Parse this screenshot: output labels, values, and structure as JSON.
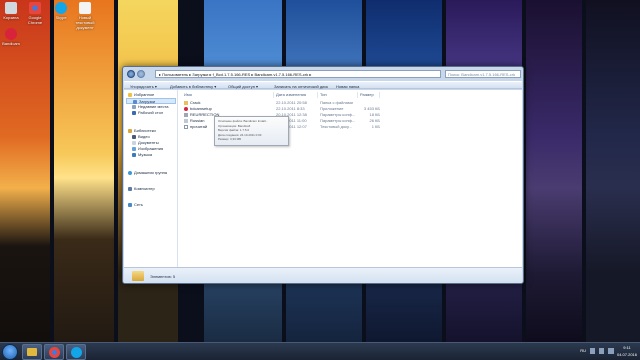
{
  "desktop": {
    "icons": [
      {
        "label": "Корзина",
        "name": "recycle-bin-icon",
        "color": "#d0d8e0"
      },
      {
        "label": "Google Chrome",
        "name": "chrome-icon",
        "color": "#e8453c"
      },
      {
        "label": "Skype",
        "name": "skype-icon",
        "color": "#12a5e8"
      },
      {
        "label": "Новый текстовый документ",
        "name": "text-document-icon",
        "color": "#f4f4f4"
      },
      {
        "label": "Bandicam",
        "name": "bandicam-icon",
        "color": "#d8243a"
      }
    ]
  },
  "window": {
    "path": "▸ Пользователь ▸ Загрузки ▸ f_Bcd.1.7.5.166-RES ▸ Bandicam.v1.7.5.166-RES-crk ▸",
    "search_placeholder": "Поиск: Bandicam.v1.7.5.166-RES-crk",
    "toolbar": {
      "organize": "Упорядочить ▾",
      "add_library": "Добавить в библиотеку ▾",
      "share": "Общий доступ ▾",
      "burn": "Записать на оптический диск",
      "new_folder": "Новая папка"
    },
    "nav": {
      "favorites": "Избранное",
      "downloads": "Загрузки",
      "recent": "Недавние места",
      "desktop": "Рабочий стол",
      "libraries": "Библиотеки",
      "video": "Видео",
      "documents": "Документы",
      "pictures": "Изображения",
      "music": "Музыка",
      "homegroup": "Домашняя группа",
      "computer": "Компьютер",
      "network": "Сеть"
    },
    "columns": {
      "name": "Имя",
      "date": "Дата изменения",
      "type": "Тип",
      "size": "Размер"
    },
    "files": [
      {
        "name": "Crack",
        "date": "22.10.2011 20:58",
        "type": "Папка с файлами",
        "size": "",
        "icon": "folder-icon"
      },
      {
        "name": "bdcamsetup",
        "date": "22.10.2011 8:33",
        "type": "Приложение",
        "size": "3 453 КБ",
        "icon": "setup-icon"
      },
      {
        "name": "REURRECTION",
        "date": "20.10.2011 12:38",
        "type": "Параметры конф...",
        "size": "18 КБ",
        "icon": "nfo-icon"
      },
      {
        "name": "Russian",
        "date": "12.10.2011 11:00",
        "type": "Параметры конф...",
        "size": "26 КБ",
        "icon": "ini-icon"
      },
      {
        "name": "прочитай",
        "date": "22.10.2011 12:07",
        "type": "Текстовый доку...",
        "size": "1 КБ",
        "icon": "txt-icon"
      }
    ],
    "tooltip": [
      "Описание файла: Bandicam Install...",
      "Организация: Bandisoft",
      "Версия файла: 1.7.5.0",
      "Дата создания: 24.10.2011 0:03",
      "Размер: 3,33 МБ"
    ],
    "status": "Элементов: 5"
  },
  "taskbar": {
    "lang": "RU",
    "time": "9:11",
    "date": "04.07.2016"
  }
}
